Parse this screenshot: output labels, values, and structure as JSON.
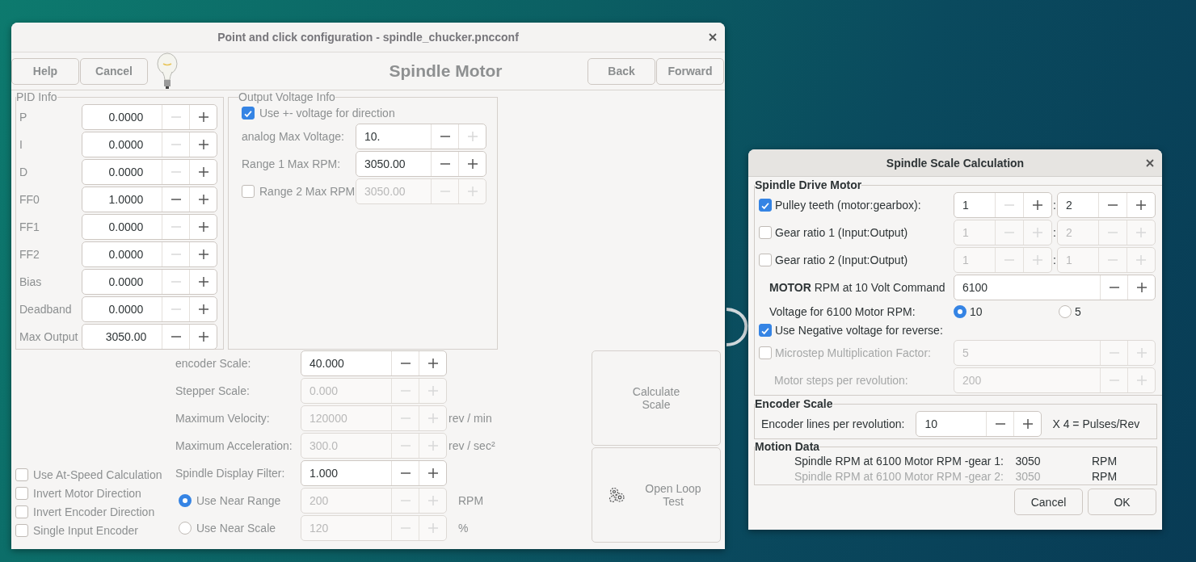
{
  "main_window": {
    "title": "Point and click configuration - spindle_chucker.pncconf",
    "left_buttons": [
      {
        "label": "Help"
      },
      {
        "label": "Cancel"
      }
    ],
    "heading": "Spindle Motor",
    "right_buttons": [
      {
        "label": "Back"
      },
      {
        "label": "Forward"
      }
    ],
    "pid_info": {
      "title": "PID Info",
      "rows": [
        {
          "label": "P",
          "spin": {
            "value": "0.0000",
            "disabled": false,
            "minus_disabled": true,
            "plus_disabled": false
          }
        },
        {
          "label": "I",
          "spin": {
            "value": "0.0000",
            "disabled": false,
            "minus_disabled": true,
            "plus_disabled": false
          }
        },
        {
          "label": "D",
          "spin": {
            "value": "0.0000",
            "disabled": false,
            "minus_disabled": true,
            "plus_disabled": false
          }
        },
        {
          "label": "FF0",
          "spin": {
            "value": "1.0000",
            "disabled": false,
            "minus_disabled": false,
            "plus_disabled": false
          }
        },
        {
          "label": "FF1",
          "spin": {
            "value": "0.0000",
            "disabled": false,
            "minus_disabled": true,
            "plus_disabled": false
          }
        },
        {
          "label": "FF2",
          "spin": {
            "value": "0.0000",
            "disabled": false,
            "minus_disabled": true,
            "plus_disabled": false
          }
        },
        {
          "label": "Bias",
          "spin": {
            "value": "0.0000",
            "disabled": false,
            "minus_disabled": true,
            "plus_disabled": false
          }
        },
        {
          "label": "Deadband",
          "spin": {
            "value": "0.0000",
            "disabled": false,
            "minus_disabled": true,
            "plus_disabled": false
          }
        },
        {
          "label": "Max Output",
          "spin": {
            "value": "3050.00",
            "disabled": false,
            "minus_disabled": false,
            "plus_disabled": false
          }
        }
      ]
    },
    "output_voltage": {
      "title": "Output Voltage Info",
      "rows": [
        {
          "kind": "check",
          "label": "Use +- voltage for direction",
          "checked": true
        },
        {
          "kind": "spin",
          "label": "analog Max Voltage:",
          "spin": {
            "value": "10.",
            "disabled": false,
            "minus_disabled": false,
            "plus_disabled": true
          }
        },
        {
          "kind": "spin",
          "label": "Range 1 Max RPM:",
          "spin": {
            "value": "3050.00",
            "disabled": false,
            "minus_disabled": false,
            "plus_disabled": false
          }
        },
        {
          "kind": "check_spin",
          "label": "Range 2 Max RPM",
          "checked": false,
          "spin": {
            "value": "3050.00",
            "disabled": true,
            "minus_disabled": true,
            "plus_disabled": true
          }
        }
      ]
    },
    "options": [
      {
        "label": "Use At-Speed Calculation",
        "checked": false
      },
      {
        "label": "Invert Motor Direction",
        "checked": false
      },
      {
        "label": "Invert Encoder Direction",
        "checked": false
      },
      {
        "label": "Single Input Encoder",
        "checked": false
      }
    ],
    "settings": [
      {
        "kind": "label",
        "label": "encoder Scale:",
        "spin": {
          "value": "40.000",
          "disabled": false,
          "minus_disabled": false,
          "plus_disabled": false
        }
      },
      {
        "kind": "label",
        "label": "Stepper Scale:",
        "spin": {
          "value": "0.000",
          "disabled": true,
          "minus_disabled": true,
          "plus_disabled": true
        }
      },
      {
        "kind": "label",
        "label": "Maximum Velocity:",
        "spin": {
          "value": "120000",
          "disabled": true,
          "minus_disabled": true,
          "plus_disabled": true
        },
        "unit": "rev / min"
      },
      {
        "kind": "label",
        "label": "Maximum Acceleration:",
        "spin": {
          "value": "300.0",
          "disabled": true,
          "minus_disabled": true,
          "plus_disabled": true
        },
        "unit": "rev / sec²"
      },
      {
        "kind": "label",
        "label": "Spindle Display Filter:",
        "spin": {
          "value": "1.000",
          "disabled": false,
          "minus_disabled": false,
          "plus_disabled": false
        }
      },
      {
        "kind": "radio",
        "label": "Use Near Range",
        "selected": true,
        "spin": {
          "value": "200",
          "disabled": true,
          "minus_disabled": true,
          "plus_disabled": true
        },
        "unit": "RPM"
      },
      {
        "kind": "radio",
        "label": "Use Near Scale",
        "selected": false,
        "spin": {
          "value": "120",
          "disabled": true,
          "minus_disabled": true,
          "plus_disabled": true
        },
        "unit": "%"
      }
    ],
    "action_buttons": [
      {
        "kind": "plain",
        "label": "Calculate Scale"
      },
      {
        "kind": "gears",
        "label": "Open Loop Test"
      }
    ]
  },
  "dialog": {
    "title": "Spindle Scale Calculation",
    "drive_motor": {
      "title": "Spindle Drive Motor",
      "rows": [
        {
          "kind": "ratio",
          "label": "Pulley teeth (motor:gearbox):",
          "checked": true,
          "first": {
            "value": "1",
            "disabled": false,
            "minus_disabled": true,
            "plus_disabled": false
          },
          "separator": ":",
          "second": {
            "value": "2",
            "disabled": false,
            "minus_disabled": false,
            "plus_disabled": false
          }
        },
        {
          "kind": "ratio",
          "label": "Gear ratio 1 (Input:Output)",
          "checked": false,
          "first": {
            "value": "1",
            "disabled": true,
            "minus_disabled": true,
            "plus_disabled": true
          },
          "separator": ":",
          "second": {
            "value": "2",
            "disabled": true,
            "minus_disabled": true,
            "plus_disabled": true
          }
        },
        {
          "kind": "ratio",
          "label": "Gear ratio 2 (Input:Output)",
          "checked": false,
          "first": {
            "value": "1",
            "disabled": true,
            "minus_disabled": true,
            "plus_disabled": true
          },
          "separator": ":",
          "second": {
            "value": "1",
            "disabled": true,
            "minus_disabled": true,
            "plus_disabled": true
          }
        },
        {
          "kind": "spin",
          "label": "**MOTOR** RPM at 10 Volt Command",
          "disabled": false,
          "spin": {
            "value": "6100",
            "disabled": false,
            "minus_disabled": false,
            "plus_disabled": false
          }
        },
        {
          "kind": "radio",
          "label": "Voltage for 6100 Motor RPM:",
          "options": [
            {
              "label": "10",
              "selected": true
            },
            {
              "label": "5",
              "selected": false
            }
          ]
        },
        {
          "kind": "check",
          "label": "Use Negative voltage for reverse:",
          "checked": true
        },
        {
          "kind": "check_spin",
          "label": "Microstep Multiplication Factor:",
          "checked": false,
          "disabled": true,
          "spin": {
            "value": "5",
            "disabled": true,
            "minus_disabled": true,
            "plus_disabled": true
          }
        },
        {
          "kind": "spin",
          "label": "Motor steps per revolution:",
          "disabled": true,
          "spin": {
            "value": "200",
            "disabled": true,
            "minus_disabled": true,
            "plus_disabled": true
          }
        }
      ]
    },
    "encoder": {
      "title": "Encoder Scale",
      "label": "Encoder lines per revolution:",
      "spin": {
        "value": "10",
        "disabled": false,
        "minus_disabled": false,
        "plus_disabled": false
      },
      "suffix": "X 4 = Pulses/Rev"
    },
    "motion": {
      "title": "Motion Data",
      "rows": [
        {
          "label": "Spindle RPM at 6100 Motor RPM -gear 1:",
          "value": "3050",
          "unit": "RPM",
          "disabled": false
        },
        {
          "label": "Spindle RPM at 6100 Motor RPM -gear 2:",
          "value": "3050",
          "unit": "RPM",
          "disabled": true
        }
      ]
    },
    "buttons": [
      {
        "label": "Cancel"
      },
      {
        "label": "OK"
      }
    ]
  }
}
